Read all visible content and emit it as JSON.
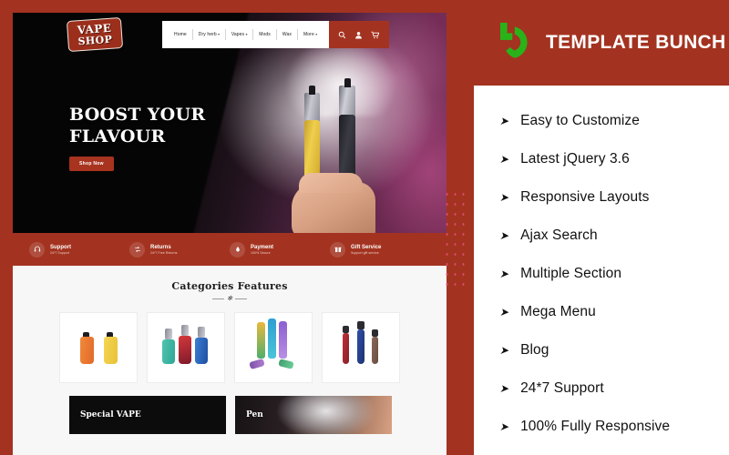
{
  "theme": {
    "brand_red": "#a33320",
    "logo_green": "#28b419",
    "dot_pink": "#d6496b",
    "panel_bg": "#f7f7f7"
  },
  "preview": {
    "site_logo": {
      "line1": "VAPE",
      "line2": "SHOP"
    },
    "nav": {
      "items": [
        {
          "label": "Home",
          "has_caret": false
        },
        {
          "label": "Dry herb",
          "has_caret": true
        },
        {
          "label": "Vapes",
          "has_caret": true
        },
        {
          "label": "Mods",
          "has_caret": false
        },
        {
          "label": "Wax",
          "has_caret": false
        },
        {
          "label": "More",
          "has_caret": true
        }
      ],
      "icons": [
        "search-icon",
        "user-icon",
        "cart-icon"
      ]
    },
    "hero": {
      "title_line1": "BOOST YOUR",
      "title_line2": "FLAVOUR",
      "cta_label": "Shop Now"
    },
    "services": [
      {
        "icon": "headset-icon",
        "title": "Support",
        "subtitle": "24*7 Support"
      },
      {
        "icon": "returns-icon",
        "title": "Returns",
        "subtitle": "24*7 Free Returns"
      },
      {
        "icon": "payment-icon",
        "title": "Payment",
        "subtitle": "100% Secure"
      },
      {
        "icon": "gift-icon",
        "title": "Gift Service",
        "subtitle": "Support gift service"
      }
    ],
    "categories": {
      "heading": "Categories Features",
      "cards": [
        {
          "name": "disposable-pods"
        },
        {
          "name": "mod-kits"
        },
        {
          "name": "colour-bars"
        },
        {
          "name": "slim-pens"
        }
      ]
    },
    "promos": [
      {
        "label": "Special VAPE",
        "style": "dark"
      },
      {
        "label": "Pen",
        "style": "photo"
      }
    ]
  },
  "right": {
    "brand_name": "Template Bunch",
    "brand_display": "TEMPLATE BUNCH",
    "features": [
      {
        "bullet": "➤",
        "label": "Easy to Customize"
      },
      {
        "bullet": "➤",
        "label": "Latest jQuery 3.6"
      },
      {
        "bullet": "➤",
        "label": "Responsive Layouts"
      },
      {
        "bullet": "➤",
        "label": "Ajax Search"
      },
      {
        "bullet": "➤",
        "label": "Multiple Section"
      },
      {
        "bullet": "➤",
        "label": "Mega Menu"
      },
      {
        "bullet": "➤",
        "label": "Blog"
      },
      {
        "bullet": "➤",
        "label": "24*7 Support"
      },
      {
        "bullet": "➤",
        "label": "100% Fully Responsive"
      }
    ]
  }
}
